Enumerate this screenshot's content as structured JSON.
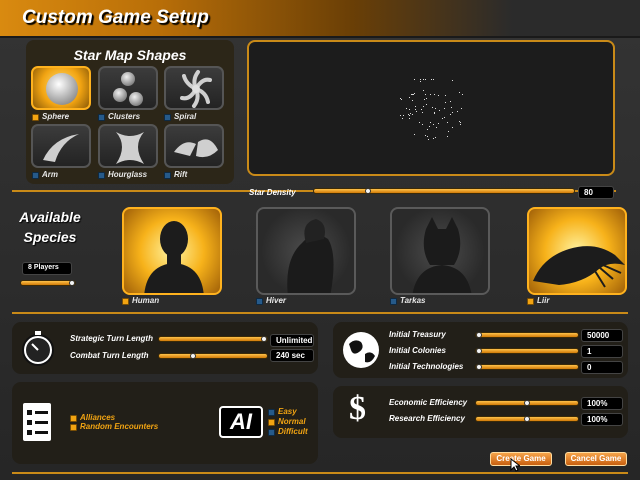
{
  "window": {
    "title": "Custom Game Setup"
  },
  "star_map": {
    "heading": "Star Map Shapes",
    "shapes": [
      {
        "label": "Sphere",
        "selected": true
      },
      {
        "label": "Clusters",
        "selected": false
      },
      {
        "label": "Spiral",
        "selected": false
      },
      {
        "label": "Arm",
        "selected": false
      },
      {
        "label": "Hourglass",
        "selected": false
      },
      {
        "label": "Rift",
        "selected": false
      }
    ],
    "density_label": "Star Density",
    "density_value": "80",
    "density_fraction": 0.2
  },
  "species": {
    "heading_line1": "Available",
    "heading_line2": "Species",
    "players_value": "8 Players",
    "players_fraction": 1.0,
    "list": [
      {
        "label": "Human",
        "selected": true
      },
      {
        "label": "Hiver",
        "selected": false
      },
      {
        "label": "Tarkas",
        "selected": false
      },
      {
        "label": "Liir",
        "selected": true
      }
    ]
  },
  "turns": {
    "strategic_label": "Strategic Turn Length",
    "strategic_value": "Unlimited",
    "strategic_fraction": 1.0,
    "combat_label": "Combat Turn Length",
    "combat_value": "240 sec",
    "combat_fraction": 0.3
  },
  "economy": {
    "treasury_label": "Initial Treasury",
    "treasury_value": "50000",
    "treasury_fraction": 0.0,
    "colonies_label": "Initial Colonies",
    "colonies_value": "1",
    "colonies_fraction": 0.0,
    "tech_label": "Initial Technologies",
    "tech_value": "0",
    "tech_fraction": 0.0
  },
  "options": {
    "alliances_label": "Alliances",
    "random_encounters_label": "Random Encounters"
  },
  "ai": {
    "logo_text": "AI",
    "levels": [
      {
        "label": "Easy",
        "selected": false
      },
      {
        "label": "Normal",
        "selected": true
      },
      {
        "label": "Difficult",
        "selected": false
      }
    ]
  },
  "efficiency": {
    "economic_label": "Economic Efficiency",
    "economic_value": "100%",
    "economic_fraction": 0.5,
    "research_label": "Research Efficiency",
    "research_value": "100%",
    "research_fraction": 0.5
  },
  "buttons": {
    "create": "Create Game",
    "cancel": "Cancel Game"
  },
  "colors": {
    "accent": "#f2a412",
    "frame": "#c98a18"
  }
}
